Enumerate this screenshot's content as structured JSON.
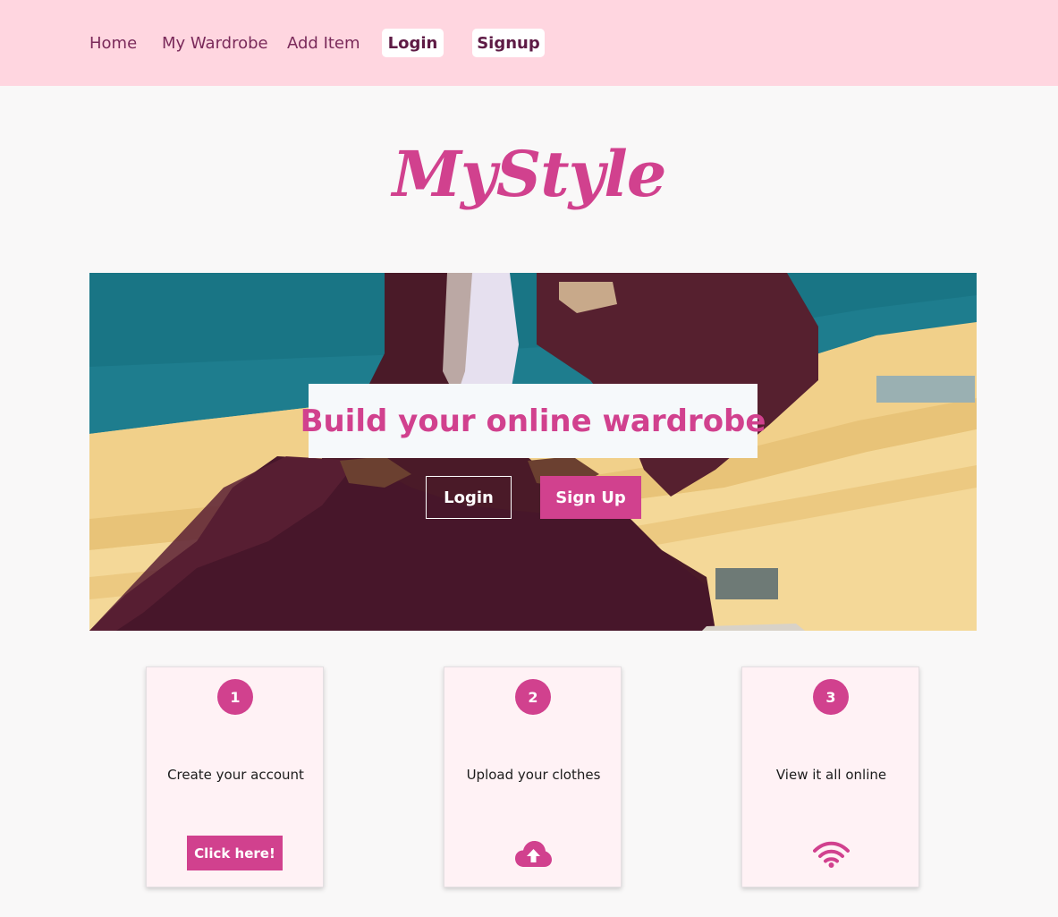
{
  "nav": {
    "links": [
      "Home",
      "My Wardrobe",
      "Add Item"
    ],
    "login_label": "Login",
    "signup_label": "Signup"
  },
  "logo": {
    "text": "MyStyle"
  },
  "hero": {
    "title": "Build your online wardrobe",
    "login_label": "Login",
    "signup_label": "Sign Up"
  },
  "steps": [
    {
      "number": "1",
      "text": "Create your account",
      "button_label": "Click here!"
    },
    {
      "number": "2",
      "text": "Upload your clothes",
      "icon": "cloud-upload-icon"
    },
    {
      "number": "3",
      "text": "View it all online",
      "icon": "wifi-icon"
    }
  ],
  "colors": {
    "accent": "#d1418e",
    "navbar_bg": "#ffd6e0",
    "card_bg": "#fff2f5",
    "page_bg": "#f9f8f8"
  }
}
